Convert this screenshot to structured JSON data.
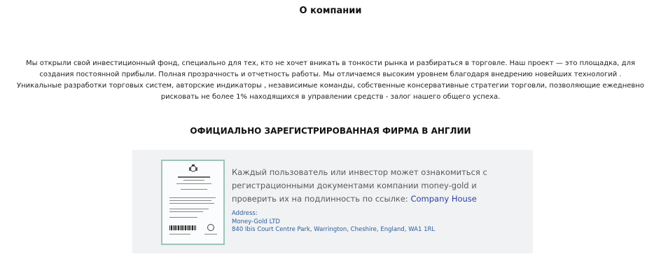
{
  "about": {
    "title": "О компании",
    "paragraph": "Мы открыли свой инвестиционный фонд, специально для тех, кто не хочет вникать в тонкости рынка и разбираться в торговле. Наш проект — это площадка, для создания постоянной прибыли. Полная прозрачность и отчетность работы. Мы отличаемся высоким уровнем благодаря внедрению новейших технологий . Уникальные разработки торговых систем, авторские индикаторы , независимые команды, собственные консервативные стратегии торговли, позволяющие ежедневно рисковать не более 1% находящихся в управлении средств - залог нашего общего успеха."
  },
  "registration": {
    "heading": "ОФИЦИАЛЬНО ЗАРЕГИСТРИРОВАННАЯ ФИРМА В АНГЛИИ",
    "description": "Каждый пользователь или инвестор может ознакомиться с регистрационными документами компании money-gold и проверить их на подлинность по ссылке: ",
    "link_label": "Company House",
    "address_label": "Address:",
    "company_name": "Money-Gold LTD",
    "address_line": "840 Ibis Court Centre Park, Warrington, Cheshire, England, WA1 1RL",
    "certificate_icon": "certificate-document-icon"
  }
}
